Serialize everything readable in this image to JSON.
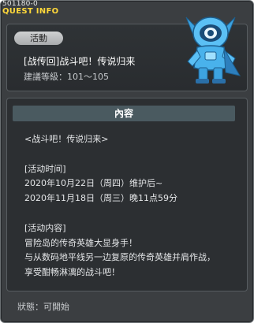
{
  "header": {
    "quest_id": "501180-0",
    "section_title": "QUEST INFO"
  },
  "quest": {
    "category": "活動",
    "title": "[战传回]战斗吧！传说归来",
    "level_requirement": "建議等級：101～105"
  },
  "content": {
    "header": "內容",
    "lines": [
      "<战斗吧！传说归来>",
      "",
      "[活动时间]",
      "2020年10月22日（周四）维护后~",
      "2020年11月18日（周三）晚11点59分",
      "",
      "[活动内容]",
      "冒险岛的传奇英雄大显身手！",
      "与从数码地平线另一边复原的传奇英雄并肩作战，",
      "享受酣畅淋漓的战斗吧！"
    ]
  },
  "footer": {
    "status": "狀態：可開始"
  },
  "mascot": {
    "icon": "blue-robot-mascot-icon"
  }
}
